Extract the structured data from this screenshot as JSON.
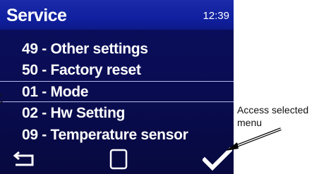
{
  "header": {
    "title": "Service",
    "clock": "12:39"
  },
  "menu": {
    "items": [
      {
        "label": "49 - Other settings",
        "selected": false
      },
      {
        "label": "50 - Factory reset",
        "selected": false
      },
      {
        "label": "01 - Mode",
        "selected": true
      },
      {
        "label": "02 - Hw Setting",
        "selected": false
      },
      {
        "label": "09 - Temperature sensor",
        "selected": false
      }
    ]
  },
  "softkeys": {
    "left": "back-arrow-icon",
    "center": "home-square-icon",
    "right": "checkmark-icon"
  },
  "annotation": {
    "line1": "Access selected",
    "line2": "menu"
  },
  "colors": {
    "screen_bg": "#0a0d55",
    "title_bar": "#1020a0",
    "text": "#ffffff",
    "divider": "#b7bbe6"
  }
}
